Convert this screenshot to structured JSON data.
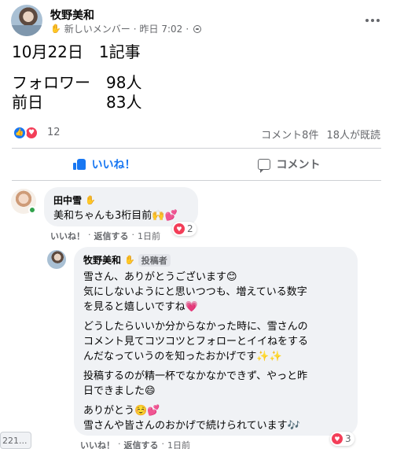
{
  "post": {
    "author": "牧野美和",
    "badge_icon": "wave-hand-icon",
    "member_label": "新しいメンバー",
    "time": "昨日 7:02",
    "body": {
      "line1": "10月22日　1記事",
      "line2": "フォロワー　98人",
      "line3": "前日　　　　83人"
    }
  },
  "reactions": {
    "count": "12",
    "comments": "コメント8件",
    "seen": "18人が既読"
  },
  "actions": {
    "like_label": "いいね！",
    "comment_label": "コメント"
  },
  "comments": [
    {
      "name": "田中雪",
      "text": "美和ちゃんも3桁目前🙌💕",
      "reaction_count": "2",
      "like": "いいね！",
      "reply": "返信する",
      "time": "1日前"
    },
    {
      "name": "牧野美和",
      "role": "投稿者",
      "p1_l1": "雪さん、ありがとうございます😊",
      "p1_l2": "気にしないようにと思いつつも、増えている数字",
      "p1_l3": "を見ると嬉しいですね💗",
      "p2_l1": "どうしたらいいか分からなかった時に、雪さんの",
      "p2_l2": "コメント見てコツコツとフォローとイイねをする",
      "p2_l3": "んだなっていうのを知ったおかげです✨✨",
      "p3_l1": "投稿するのが精一杯でなかなかできず、やっと昨",
      "p3_l2": "日できました😄",
      "p4_l1": "ありがとう☺️💕",
      "p4_l2": "雪さんや皆さんのおかげで続けられています🎶",
      "reaction_count": "3",
      "like": "いいね！",
      "reply": "返信する",
      "time": "1日前"
    }
  ],
  "sidechip": "221..."
}
